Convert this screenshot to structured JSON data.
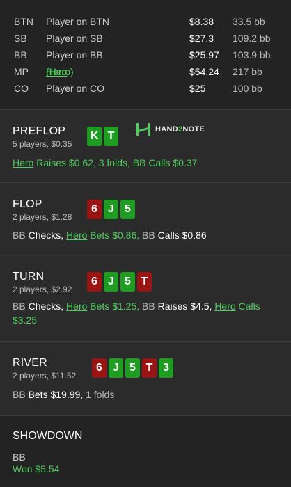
{
  "players": [
    {
      "pos": "BTN",
      "name": "Player on BTN",
      "hero": false,
      "stack": "$8.38",
      "bb": "33.5 bb"
    },
    {
      "pos": "SB",
      "name": "Player on SB",
      "hero": false,
      "stack": "$27.3",
      "bb": "109.2 bb"
    },
    {
      "pos": "BB",
      "name": "Player on BB",
      "hero": false,
      "stack": "$25.97",
      "bb": "103.9 bb"
    },
    {
      "pos": "MP",
      "name": "Hero",
      "hero_tag": "(Hero)",
      "hero": true,
      "stack": "$54.24",
      "bb": "217 bb"
    },
    {
      "pos": "CO",
      "name": "Player on CO",
      "hero": false,
      "stack": "$25",
      "bb": "100 bb"
    }
  ],
  "logo": {
    "text_a": "HAND",
    "text_b": "2",
    "text_c": "NOTE"
  },
  "preflop": {
    "title": "PREFLOP",
    "sub": "5 players, $0.35",
    "cards": [
      {
        "rank": "K",
        "color": "green"
      },
      {
        "rank": "T",
        "color": "green"
      }
    ],
    "actions": [
      {
        "t": "Hero",
        "cls": "a-hero"
      },
      {
        "t": " Raises $0.62, 3 folds, ",
        "cls": "a-green"
      },
      {
        "t": "BB ",
        "cls": "a-green"
      },
      {
        "t": "Calls $0.37",
        "cls": "a-green"
      }
    ]
  },
  "flop": {
    "title": "FLOP",
    "sub": "2 players, $1.28",
    "cards": [
      {
        "rank": "6",
        "color": "red"
      },
      {
        "rank": "J",
        "color": "green"
      },
      {
        "rank": "5",
        "color": "green"
      }
    ],
    "actions": [
      {
        "t": "BB ",
        "cls": "a-grey"
      },
      {
        "t": "Checks, ",
        "cls": "a-white"
      },
      {
        "t": "Hero",
        "cls": "a-hero"
      },
      {
        "t": " Bets $0.86, ",
        "cls": "a-green"
      },
      {
        "t": "BB ",
        "cls": "a-grey"
      },
      {
        "t": "Calls $0.86",
        "cls": "a-white"
      }
    ]
  },
  "turn": {
    "title": "TURN",
    "sub": "2 players, $2.92",
    "cards": [
      {
        "rank": "6",
        "color": "red"
      },
      {
        "rank": "J",
        "color": "green"
      },
      {
        "rank": "5",
        "color": "green"
      },
      {
        "rank": "T",
        "color": "red"
      }
    ],
    "actions": [
      {
        "t": "BB ",
        "cls": "a-grey"
      },
      {
        "t": "Checks, ",
        "cls": "a-white"
      },
      {
        "t": "Hero",
        "cls": "a-hero"
      },
      {
        "t": " Bets $1.25, ",
        "cls": "a-green"
      },
      {
        "t": "BB ",
        "cls": "a-grey"
      },
      {
        "t": "Raises $4.5, ",
        "cls": "a-white"
      },
      {
        "t": "Hero",
        "cls": "a-hero"
      },
      {
        "t": " Calls $3.25",
        "cls": "a-green"
      }
    ]
  },
  "river": {
    "title": "RIVER",
    "sub": "2 players, $11.52",
    "cards": [
      {
        "rank": "6",
        "color": "red"
      },
      {
        "rank": "J",
        "color": "green"
      },
      {
        "rank": "5",
        "color": "green"
      },
      {
        "rank": "T",
        "color": "red"
      },
      {
        "rank": "3",
        "color": "green"
      }
    ],
    "actions": [
      {
        "t": "BB ",
        "cls": "a-grey"
      },
      {
        "t": "Bets $19.99, ",
        "cls": "a-white"
      },
      {
        "t": "1 folds",
        "cls": "a-grey"
      }
    ]
  },
  "showdown": {
    "title": "SHOWDOWN",
    "player": "BB",
    "won": "Won $5.54"
  }
}
